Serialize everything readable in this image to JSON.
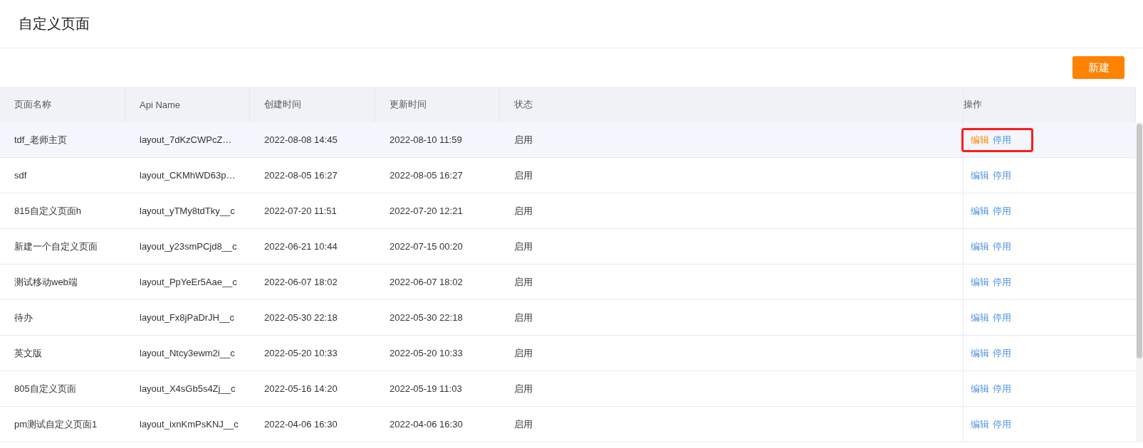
{
  "page_title": "自定义页面",
  "new_button": "新建",
  "table": {
    "columns": [
      "页面名称",
      "Api Name",
      "创建时间",
      "更新时间",
      "状态",
      "操作"
    ],
    "rows": [
      {
        "cells": [
          "tdf_老师主页",
          "layout_7dKzCWPcZ…",
          "2022-08-08 14:45",
          "2022-08-10 11:59",
          "启用"
        ],
        "actions": [
          "编辑",
          "停用"
        ],
        "hovered": true,
        "annotated": true
      },
      {
        "cells": [
          "sdf",
          "layout_CKMhWD63p…",
          "2022-08-05 16:27",
          "2022-08-05 16:27",
          "启用"
        ],
        "actions": [
          "编辑",
          "停用"
        ],
        "hovered": false,
        "annotated": false
      },
      {
        "cells": [
          "815自定义页面h",
          "layout_yTMy8tdTky__c",
          "2022-07-20 11:51",
          "2022-07-20 12:21",
          "启用"
        ],
        "actions": [
          "编辑",
          "停用"
        ],
        "hovered": false,
        "annotated": false
      },
      {
        "cells": [
          "新建一个自定义页面",
          "layout_y23smPCjd8__c",
          "2022-06-21 10:44",
          "2022-07-15 00:20",
          "启用"
        ],
        "actions": [
          "编辑",
          "停用"
        ],
        "hovered": false,
        "annotated": false
      },
      {
        "cells": [
          "测试移动web端",
          "layout_PpYeEr5Aae__c",
          "2022-06-07 18:02",
          "2022-06-07 18:02",
          "启用"
        ],
        "actions": [
          "编辑",
          "停用"
        ],
        "hovered": false,
        "annotated": false
      },
      {
        "cells": [
          "待办",
          "layout_Fx8jPaDrJH__c",
          "2022-05-30 22:18",
          "2022-05-30 22:18",
          "启用"
        ],
        "actions": [
          "编辑",
          "停用"
        ],
        "hovered": false,
        "annotated": false
      },
      {
        "cells": [
          "英文版",
          "layout_Ntcy3ewm2i__c",
          "2022-05-20 10:33",
          "2022-05-20 10:33",
          "启用"
        ],
        "actions": [
          "编辑",
          "停用"
        ],
        "hovered": false,
        "annotated": false
      },
      {
        "cells": [
          "805自定义页面",
          "layout_X4sGb5s4Zj__c",
          "2022-05-16 14:20",
          "2022-05-19 11:03",
          "启用"
        ],
        "actions": [
          "编辑",
          "停用"
        ],
        "hovered": false,
        "annotated": false
      },
      {
        "cells": [
          "pm测试自定义页面1",
          "layout_ixnKmPsKNJ__c",
          "2022-04-06 16:30",
          "2022-04-06 16:30",
          "启用"
        ],
        "actions": [
          "编辑",
          "停用"
        ],
        "hovered": false,
        "annotated": false
      }
    ]
  }
}
